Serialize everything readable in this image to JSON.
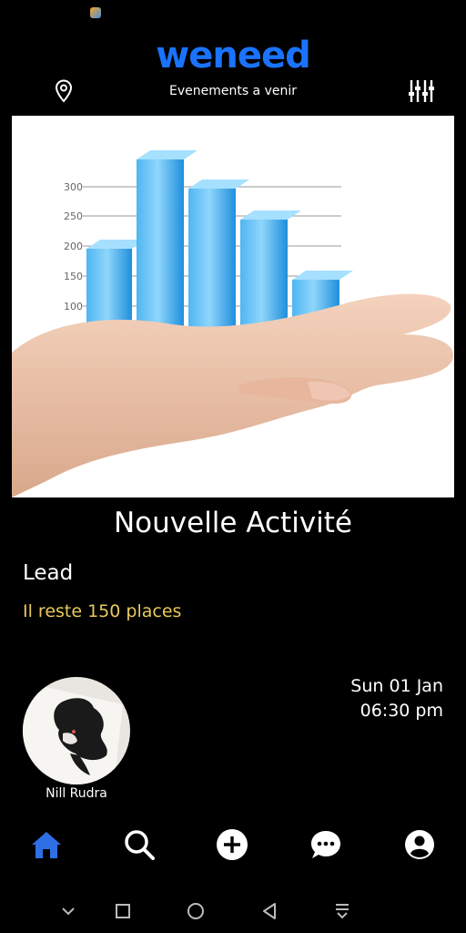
{
  "app": {
    "logo": "weneed",
    "subtitle": "Evenements a venir"
  },
  "event": {
    "title": "Nouvelle Activité",
    "category": "Lead",
    "places_left": "Il reste 150 places",
    "host_name": "Nill Rudra",
    "date": "Sun 01 Jan",
    "time": "06:30 pm"
  },
  "hero_chart": {
    "y_ticks": [
      "300",
      "250",
      "200",
      "150",
      "100"
    ]
  },
  "colors": {
    "brand": "#1a73ff",
    "accent_text": "#e8c95b",
    "active_nav": "#2f6fe6",
    "background": "#000000"
  },
  "bottom_nav": [
    {
      "icon": "home-icon",
      "active": true
    },
    {
      "icon": "search-icon",
      "active": false
    },
    {
      "icon": "add-icon",
      "active": false
    },
    {
      "icon": "chat-icon",
      "active": false
    },
    {
      "icon": "profile-icon",
      "active": false
    }
  ]
}
